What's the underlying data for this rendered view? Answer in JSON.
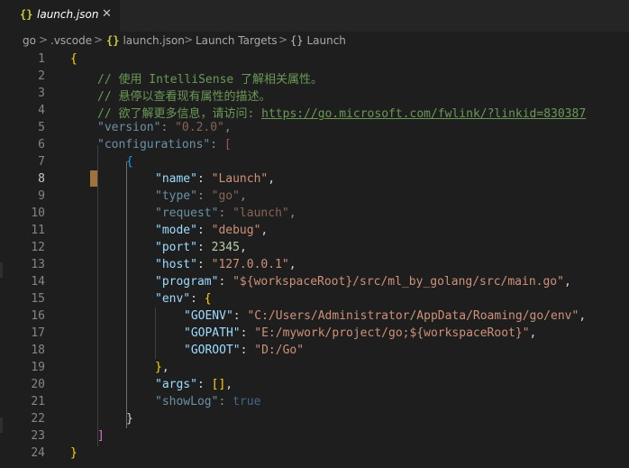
{
  "tab": {
    "icon": "{}",
    "label": "launch.json",
    "close": "✕"
  },
  "breadcrumb": {
    "items": [
      "go",
      ".vscode",
      "launch.json",
      "Launch Targets",
      "Launch"
    ],
    "json_icon": "{}",
    "object_icon": "{}",
    "sep": ">"
  },
  "editor": {
    "line_numbers": [
      "1",
      "2",
      "3",
      "4",
      "5",
      "6",
      "7",
      "8",
      "9",
      "10",
      "11",
      "12",
      "13",
      "14",
      "15",
      "16",
      "17",
      "18",
      "19",
      "20",
      "21",
      "22",
      "23",
      "24"
    ],
    "active_line": "8",
    "lines": {
      "l1_brace": "{",
      "l2": "// 使用 IntelliSense 了解相关属性。",
      "l3": "// 悬停以查看现有属性的描述。",
      "l4_prefix": "// 欲了解更多信息，请访问: ",
      "l4_link": "https://go.microsoft.com/fwlink/?linkid=830387",
      "l5_key": "\"version\"",
      "l5_val": "\"0.2.0\"",
      "l6_key": "\"configurations\"",
      "l6_bracket": "[",
      "l7": "{",
      "l8_key": "\"name\"",
      "l8_val": "\"Launch\"",
      "l9_key": "\"type\"",
      "l9_val": "\"go\"",
      "l10_key": "\"request\"",
      "l10_val": "\"launch\"",
      "l11_key": "\"mode\"",
      "l11_val": "\"debug\"",
      "l12_key": "\"port\"",
      "l12_val": "2345",
      "l13_key": "\"host\"",
      "l13_val": "\"127.0.0.1\"",
      "l14_key": "\"program\"",
      "l14_val": "\"${workspaceRoot}/src/ml_by_golang/src/main.go\"",
      "l15_key": "\"env\"",
      "l15_brace": "{",
      "l16_key": "\"GOENV\"",
      "l16_val": "\"C:/Users/Administrator/AppData/Roaming/go/env\"",
      "l17_key": "\"GOPATH\"",
      "l17_val": "\"E:/mywork/project/go;${workspaceRoot}\"",
      "l18_key": "\"GOROOT\"",
      "l18_val": "\"D:/Go\"",
      "l19": "}",
      "l20_key": "\"args\"",
      "l20_val": "[]",
      "l21_key": "\"showLog\"",
      "l21_val": "true",
      "l22": "}",
      "l23": "]",
      "l24": "}"
    }
  },
  "colors": {
    "background": "#1e1e1e",
    "key": "#9cdcfe",
    "string": "#ce9178",
    "number": "#b5cea8",
    "comment": "#6a9955",
    "keyword": "#569cd6"
  }
}
